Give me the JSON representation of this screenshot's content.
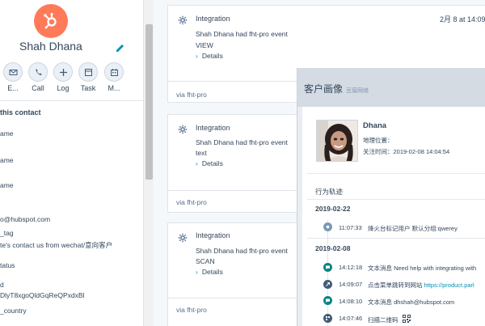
{
  "contact": {
    "name": "Shah Dhana"
  },
  "actions": [
    {
      "label": "E...",
      "icon": "email-icon"
    },
    {
      "label": "Call",
      "icon": "phone-icon"
    },
    {
      "label": "Log",
      "icon": "plus-icon"
    },
    {
      "label": "Task",
      "icon": "task-icon"
    },
    {
      "label": "M...",
      "icon": "meeting-icon"
    }
  ],
  "about": {
    "title": "this contact",
    "props": [
      "ame",
      "ame",
      "ame",
      "o@hubspot.com",
      "_tag",
      "te's contact us from wechat/意向客户",
      "tatus",
      "d",
      "DlyT8xgoQldGqReQPxdxBl",
      "_country"
    ]
  },
  "timeline": [
    {
      "title": "Integration",
      "text": "Shah Dhana had fht-pro event",
      "value": "VIEW",
      "details": "Details",
      "via": "via fht-pro",
      "date": "2月 8 at 14:09"
    },
    {
      "title": "Integration",
      "text": "Shah Dhana had fht-pro event",
      "value": "text",
      "details": "Details",
      "via": "via fht-pro"
    },
    {
      "title": "Integration",
      "text": "Shah Dhana had fht-pro event",
      "value": "SCAN",
      "details": "Details",
      "via": "via fht-pro"
    }
  ],
  "panel": {
    "title": "客户画像",
    "subtitle": "豆腐网络",
    "profile": {
      "name": "Dhana",
      "location_label": "地理位置：",
      "follow_time": "关注时间：2019-02-08 14:04:54"
    },
    "trail_title": "行为轨迹",
    "groups": [
      {
        "date": "2019-02-22",
        "events": [
          {
            "time": "11:07:33",
            "text": "烽火台标记用户 默认分组:qwerey",
            "link": "",
            "icon": "tag-icon",
            "color": "#7c98b6"
          }
        ]
      },
      {
        "date": "2019-02-08",
        "events": [
          {
            "time": "14:12:18",
            "text": "文本消息 Need help with integrating with",
            "link": "",
            "icon": "chat-icon",
            "color": "#0b8484"
          },
          {
            "time": "14:09:07",
            "text": "点击菜单跳转到网站 ",
            "link": "https://product.parl",
            "icon": "link-icon",
            "color": "#425b76"
          },
          {
            "time": "14:08:10",
            "text": "文本消息 dhshah@hubspot.com",
            "link": "",
            "icon": "chat-icon",
            "color": "#0b8484"
          },
          {
            "time": "14:07:46",
            "text": "扫描二维码",
            "link": "",
            "icon": "qrcode-icon",
            "color": "#425b76"
          }
        ]
      }
    ]
  },
  "colors": {
    "brand": "#ff7a59",
    "link": "#0091ae",
    "text": "#33475b"
  }
}
